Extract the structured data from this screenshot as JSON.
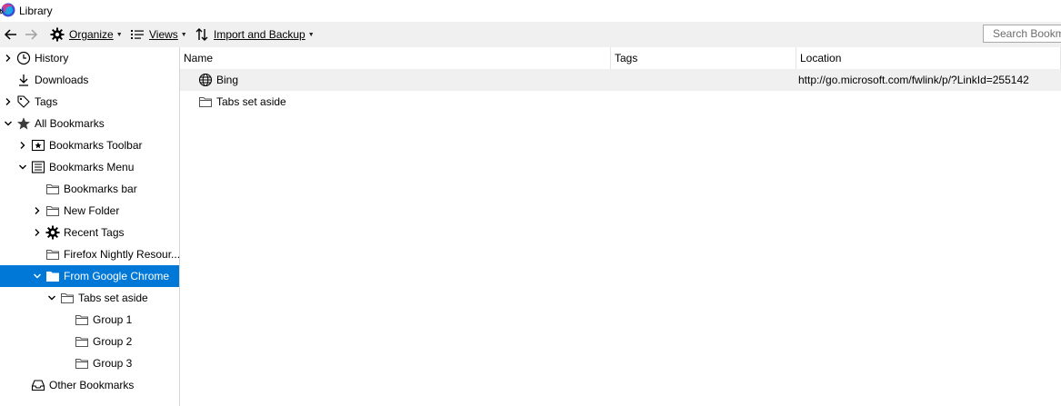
{
  "window": {
    "title": "Library"
  },
  "toolbar": {
    "organize_label": "Organize",
    "views_label": "Views",
    "import_backup_label": "Import and Backup",
    "search_placeholder": "Search Bookmarks"
  },
  "sidebar": {
    "items": [
      {
        "label": "History",
        "icon": "clock-icon",
        "expander": "collapsed"
      },
      {
        "label": "Downloads",
        "icon": "download-icon",
        "expander": "none"
      },
      {
        "label": "Tags",
        "icon": "tag-icon",
        "expander": "collapsed"
      },
      {
        "label": "All Bookmarks",
        "icon": "star-icon",
        "expander": "expanded"
      },
      {
        "label": "Bookmarks Toolbar",
        "icon": "bookmarks-toolbar-icon",
        "expander": "collapsed"
      },
      {
        "label": "Bookmarks Menu",
        "icon": "bookmarks-menu-icon",
        "expander": "expanded"
      },
      {
        "label": "Bookmarks bar",
        "icon": "folder-icon",
        "expander": "none"
      },
      {
        "label": "New Folder",
        "icon": "folder-icon",
        "expander": "collapsed"
      },
      {
        "label": "Recent Tags",
        "icon": "gear-icon",
        "expander": "collapsed"
      },
      {
        "label": "Firefox Nightly Resour...",
        "icon": "folder-icon",
        "expander": "none"
      },
      {
        "label": "From Google Chrome",
        "icon": "folder-icon",
        "expander": "expanded",
        "selected": true
      },
      {
        "label": "Tabs set aside",
        "icon": "folder-icon",
        "expander": "expanded"
      },
      {
        "label": "Group 1",
        "icon": "folder-icon",
        "expander": "none"
      },
      {
        "label": "Group 2",
        "icon": "folder-icon",
        "expander": "none"
      },
      {
        "label": "Group 3",
        "icon": "folder-icon",
        "expander": "none"
      },
      {
        "label": "Other Bookmarks",
        "icon": "inbox-icon",
        "expander": "none"
      }
    ]
  },
  "table": {
    "columns": [
      "Name",
      "Tags",
      "Location"
    ],
    "rows": [
      {
        "name": "Bing",
        "icon": "globe-icon",
        "tags": "",
        "location": "http://go.microsoft.com/fwlink/p/?LinkId=255142"
      },
      {
        "name": "Tabs set aside",
        "icon": "folder-icon",
        "tags": "",
        "location": ""
      }
    ]
  },
  "colors": {
    "selection": "#0078d7",
    "toolbar_bg": "#f0f0f0",
    "row_highlight": "#f0f0f0"
  }
}
